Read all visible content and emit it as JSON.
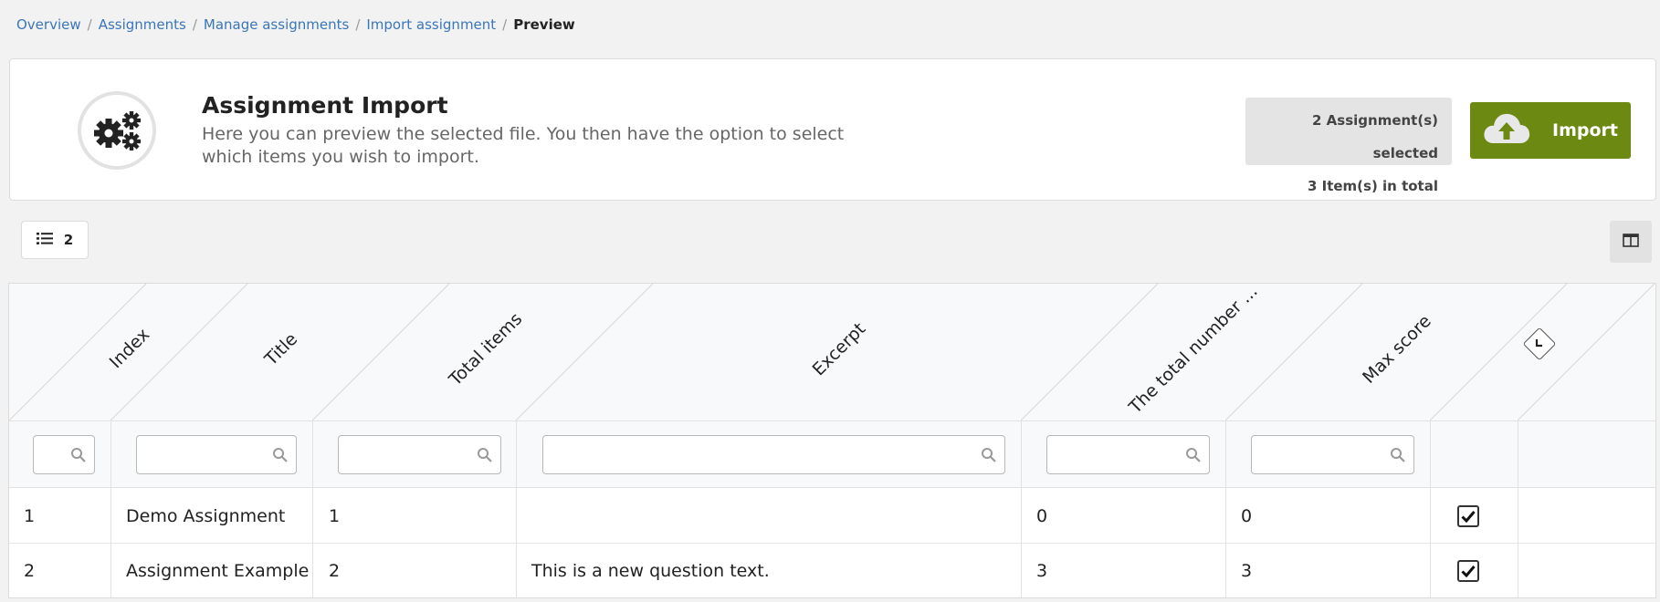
{
  "breadcrumb": {
    "items": [
      "Overview",
      "Assignments",
      "Manage assignments",
      "Import assignment"
    ],
    "current": "Preview"
  },
  "header": {
    "icon": "gears-icon",
    "title": "Assignment Import",
    "description": "Here you can preview the selected file. You then have the option to select which items you wish to import.",
    "summary_assignments": "2 Assignment(s) selected",
    "summary_items": "3 Item(s) in total",
    "import_label": "Import",
    "import_color": "#6c8a12"
  },
  "toolbar": {
    "list_count": "2",
    "list_icon": "list-icon",
    "columns_icon": "columns-icon"
  },
  "table": {
    "columns": [
      "Index",
      "Title",
      "Total items",
      "Excerpt",
      "The total number ...",
      "Max score"
    ],
    "rows": [
      {
        "index": "1",
        "title": "Demo Assignment",
        "total_items": "1",
        "excerpt": "",
        "total_number": "0",
        "max_score": "0",
        "selected": true
      },
      {
        "index": "2",
        "title": "Assignment Example",
        "total_items": "2",
        "excerpt": "This is a new question text.",
        "total_number": "3",
        "max_score": "3",
        "selected": true
      }
    ]
  }
}
